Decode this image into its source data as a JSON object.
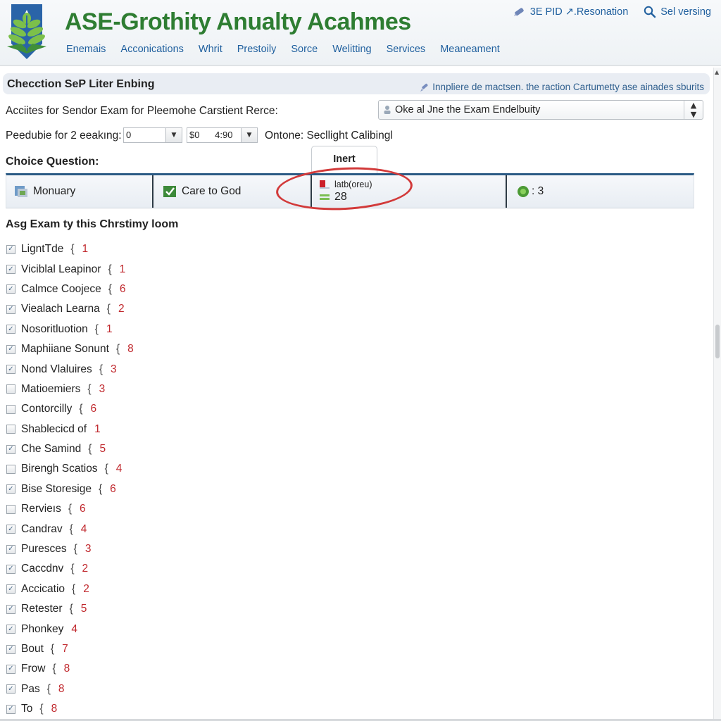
{
  "header": {
    "logo_icon": "tree-shield-logo",
    "title": "ASE-Grothity Anualty Acahmes",
    "nav": [
      "Enemais",
      "Acconications",
      "Whrit",
      "Prestoily",
      "Sorce",
      "Welitting",
      "Services",
      "Meaneament"
    ],
    "top_links": [
      {
        "icon": "pen-icon",
        "label": "3E PID ↗.Resonation"
      },
      {
        "icon": "search-icon",
        "label": "Sel versing"
      }
    ]
  },
  "section": {
    "title": "Checction SeP Liter Enbing",
    "hint": "Innpliere de mactsen. the raction Cartumetty ase ainades sburits",
    "hint_icon": "pen-icon"
  },
  "form": {
    "row1_label": "Acciites for Sendor Exam for Pleemohe Carstient Rerce:",
    "select": {
      "icon": "person-icon",
      "value": "Oke al Jne the Exam Endelbuity"
    },
    "row2_label": "Peedubie for 2 eeakıng:",
    "combo1_value": "0",
    "combo2_value": "$0      4:90",
    "row2_suffix": "Ontone:  Secllight Calibingl"
  },
  "choice": {
    "title": "Choice Question:",
    "tab_label": "Inert",
    "cells": [
      {
        "icon": "document-icon",
        "label": "Monuary"
      },
      {
        "icon": "checkbox-checked-icon",
        "label": "Care to God"
      },
      {
        "icon": "flag-icon",
        "sub_icon": "bars-icon",
        "label": "latb(oreu)",
        "value": "28"
      },
      {
        "icon": "green-badge-icon",
        "label": ": 3"
      }
    ]
  },
  "list": {
    "title": "Asg Exam ty this Chrstimy loom",
    "items": [
      {
        "label": "LigntTde",
        "brace": "{",
        "count": "1",
        "checked": true
      },
      {
        "label": "Viciblal Leapinor",
        "brace": "{",
        "count": "1",
        "checked": true
      },
      {
        "label": "Calmce Coojece",
        "brace": "{",
        "count": "6",
        "checked": true
      },
      {
        "label": "Viealach Learna",
        "brace": "{",
        "count": "2",
        "checked": true
      },
      {
        "label": "Nosoritluotion",
        "brace": "{",
        "count": "1",
        "checked": true
      },
      {
        "label": "Maphiiane Sonunt",
        "brace": "{",
        "count": "8",
        "checked": true
      },
      {
        "label": "Nond Vlaluires",
        "brace": "{",
        "count": "3",
        "checked": true
      },
      {
        "label": "Matioemiers",
        "brace": "{",
        "count": "3",
        "checked": false
      },
      {
        "label": "Contorcilly",
        "brace": "{",
        "count": "6",
        "checked": false
      },
      {
        "label": "Shablecicd of",
        "brace": "",
        "count": "1",
        "checked": false
      },
      {
        "label": "Che Samind",
        "brace": "{",
        "count": "5",
        "checked": true
      },
      {
        "label": "Birengh Scatios",
        "brace": "{",
        "count": "4",
        "checked": false
      },
      {
        "label": "Bise Storesige",
        "brace": "{",
        "count": "6",
        "checked": true
      },
      {
        "label": "Rervieıs",
        "brace": "{",
        "count": "6",
        "checked": false
      },
      {
        "label": "Candrav",
        "brace": "{",
        "count": "4",
        "checked": true
      },
      {
        "label": "Puresces",
        "brace": "{",
        "count": "3",
        "checked": true
      },
      {
        "label": "Caccdnv",
        "brace": "{",
        "count": "2",
        "checked": true
      },
      {
        "label": "Accicatio",
        "brace": "{",
        "count": "2",
        "checked": true
      },
      {
        "label": "Retester",
        "brace": "{",
        "count": "5",
        "checked": true
      },
      {
        "label": "Phonkey",
        "brace": "",
        "count": "4",
        "checked": true
      },
      {
        "label": "Bout",
        "brace": "{",
        "count": "7",
        "checked": true
      },
      {
        "label": "Frow",
        "brace": "{",
        "count": "8",
        "checked": true
      },
      {
        "label": "Pas",
        "brace": "{",
        "count": "8",
        "checked": true
      },
      {
        "label": "To",
        "brace": "{",
        "count": "8",
        "checked": true
      }
    ]
  },
  "colors": {
    "title_green": "#2e7d32",
    "nav_blue": "#1f5f9e",
    "table_border": "#2b5a84",
    "count_red": "#c0282d",
    "highlight_red": "#d23a3a"
  }
}
